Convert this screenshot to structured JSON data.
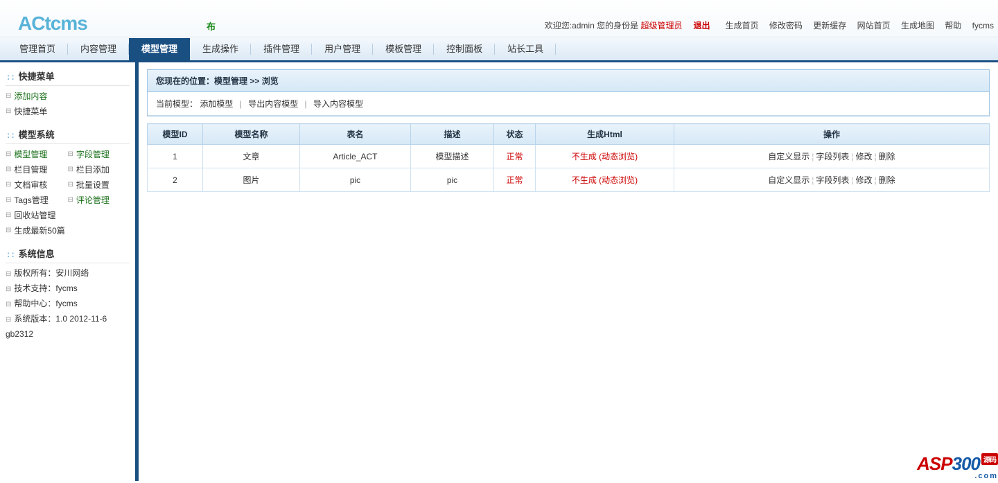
{
  "logo": "ACtcms",
  "topnews": "布",
  "topbar": {
    "welcome": "欢迎您:admin 您的身份是",
    "role": "超级管理员",
    "logout": "退出",
    "links": [
      "生成首页",
      "修改密码",
      "更新缓存",
      "网站首页",
      "生成地图",
      "帮助",
      "fycms"
    ]
  },
  "nav": [
    "管理首页",
    "内容管理",
    "模型管理",
    "生成操作",
    "插件管理",
    "用户管理",
    "模板管理",
    "控制面板",
    "站长工具"
  ],
  "nav_active": 2,
  "sidebar": {
    "quick_title": "快捷菜单",
    "quick": [
      "添加内容",
      "快捷菜单"
    ],
    "model_title": "模型系统",
    "model_rows": [
      [
        "模型管理",
        "字段管理"
      ],
      [
        "栏目管理",
        "栏目添加"
      ],
      [
        "文档审核",
        "批量设置"
      ],
      [
        "Tags管理",
        "评论管理"
      ],
      [
        "回收站管理",
        ""
      ],
      [
        "生成最新50篇",
        ""
      ]
    ],
    "sys_title": "系统信息",
    "sys": [
      "版权所有：安川网络",
      "技术支持：fycms",
      "帮助中心：fycms",
      "系统版本：1.0 2012-11-6 gb2312"
    ]
  },
  "breadcrumb": {
    "prefix": "您现在的位置：",
    "module": "模型管理",
    "arrow": " >> ",
    "page": "浏览"
  },
  "toolbar": {
    "label": "当前模型：",
    "add": "添加模型",
    "export": "导出内容模型",
    "import": "导入内容模型"
  },
  "table": {
    "headers": [
      "模型ID",
      "模型名称",
      "表名",
      "描述",
      "状态",
      "生成Html",
      "操作"
    ],
    "rows": [
      {
        "id": "1",
        "name": "文章",
        "table": "Article_ACT",
        "desc": "模型描述",
        "status": "正常",
        "html": "不生成 (动态浏览)"
      },
      {
        "id": "2",
        "name": "图片",
        "table": "pic",
        "desc": "pic",
        "status": "正常",
        "html": "不生成 (动态浏览)"
      }
    ],
    "ops": [
      "自定义显示",
      "字段列表",
      "修改",
      "删除"
    ]
  },
  "watermark": {
    "a": "ASP",
    "b": "300",
    "badge": "源码",
    "c": ".com"
  }
}
